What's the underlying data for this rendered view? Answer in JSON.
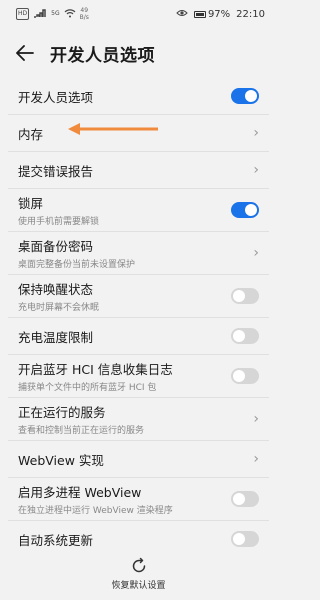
{
  "status_bar": {
    "sim_label": "HD",
    "network_label": "5G",
    "speed_value": "49",
    "speed_unit": "B/s",
    "battery": "97%",
    "battery_level": 0.97,
    "time": "22:10"
  },
  "header": {
    "title": "开发人员选项",
    "back_icon": "back-arrow-icon"
  },
  "rows": [
    {
      "title": "开发人员选项",
      "subtitle": "",
      "control": "toggle",
      "on": true
    },
    {
      "title": "内存",
      "subtitle": "",
      "control": "chevron"
    },
    {
      "title": "提交错误报告",
      "subtitle": "",
      "control": "chevron"
    },
    {
      "title": "锁屏",
      "subtitle": "使用手机前需要解锁",
      "control": "toggle",
      "on": true
    },
    {
      "title": "桌面备份密码",
      "subtitle": "桌面完整备份当前未设置保护",
      "control": "chevron"
    },
    {
      "title": "保持唤醒状态",
      "subtitle": "充电时屏幕不会休眠",
      "control": "toggle",
      "on": false
    },
    {
      "title": "充电温度限制",
      "subtitle": "",
      "control": "toggle",
      "on": false
    },
    {
      "title": "开启蓝牙 HCI 信息收集日志",
      "subtitle": "捕获单个文件中的所有蓝牙 HCI 包",
      "control": "toggle",
      "on": false
    },
    {
      "title": "正在运行的服务",
      "subtitle": "查看和控制当前正在运行的服务",
      "control": "chevron"
    },
    {
      "title": "WebView 实现",
      "subtitle": "",
      "control": "chevron"
    },
    {
      "title": "启用多进程 WebView",
      "subtitle": "在独立进程中运行 WebView 渲染程序",
      "control": "toggle",
      "on": false
    },
    {
      "title": "自动系统更新",
      "subtitle": "",
      "control": "toggle",
      "on": false
    }
  ],
  "annotation": {
    "color": "#f08a3c",
    "icon": "arrow-pointer-icon"
  },
  "colors": {
    "accent": "#1a73e8",
    "toggle_off": "#d6d6d6"
  },
  "bottom": {
    "restore_label": "恢复默认设置",
    "icon": "restore-icon"
  }
}
